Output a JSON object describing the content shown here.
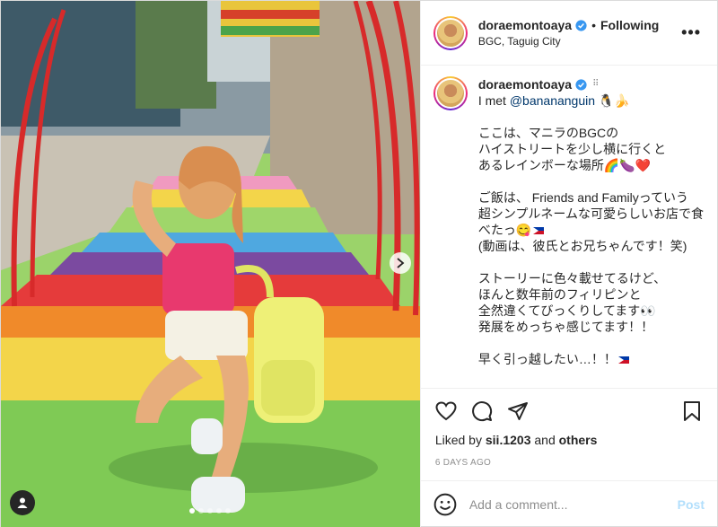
{
  "header": {
    "username": "doraemontoaya",
    "separator": "•",
    "follow_label": "Following",
    "location": "BGC, Taguig City",
    "more_label": "•••"
  },
  "caption": {
    "username": "doraemontoaya",
    "text_prefix": "I met ",
    "mention": "@banananguin",
    "text_suffix": " 🐧🍌",
    "body": "ここは、マニラのBGCの\nハイストリートを少し横に行くと\nあるレインボーな場所🌈🍆❤️\n\nご飯は、 Friends and Familyっていう\n超シンプルネームな可愛らしいお店で食\nべたっ😋",
    "body2": "(動画は、彼氏とお兄ちゃんです！笑)\n\nストーリーに色々載せてるけど、\nほんと数年前のフィリピンと\n全然違くてびっくりしてます👀\n発展をめっちゃ感じてます！！\n\n早く引っ越したい…！！"
  },
  "likes": {
    "prefix": "Liked by ",
    "user": "sii.1203",
    "middle": " and ",
    "others": "others"
  },
  "time_ago": "6 DAYS AGO",
  "comment": {
    "placeholder": "Add a comment...",
    "post_label": "Post"
  },
  "carousel": {
    "count": 5,
    "active_index": 0
  },
  "colors": {
    "verified": "#3897f0",
    "post_disabled": "#b2dffc",
    "link": "#00376b"
  },
  "icons": [
    "heart-icon",
    "comment-icon",
    "share-icon",
    "bookmark-icon",
    "emoji-icon",
    "verified-icon",
    "more-icon",
    "next-arrow-icon",
    "tagged-user-icon"
  ]
}
